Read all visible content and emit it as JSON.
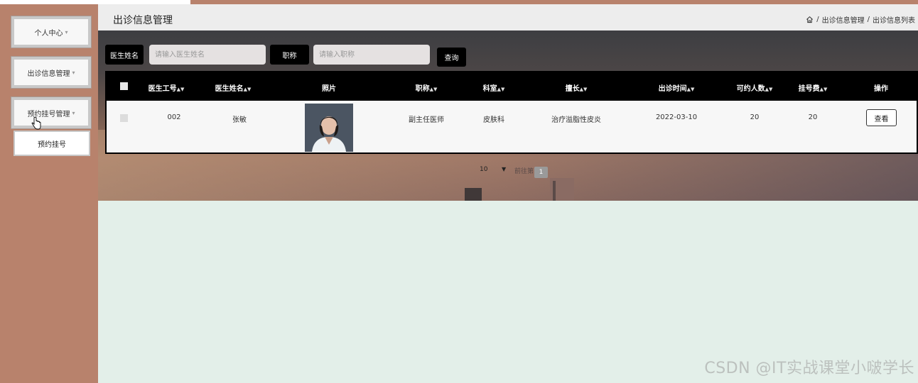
{
  "sidebar": {
    "items": [
      {
        "label": "个人中心",
        "caret": "▾"
      },
      {
        "label": "出诊信息管理",
        "caret": "▾"
      },
      {
        "label": "预约挂号管理",
        "caret": "▾"
      }
    ],
    "sub_item": "预约挂号"
  },
  "header": {
    "title": "出诊信息管理",
    "breadcrumb": [
      "出诊信息管理",
      "出诊信息列表"
    ],
    "separator": "/"
  },
  "search": {
    "doctor_name_label": "医生姓名",
    "doctor_name_placeholder": "请输入医生姓名",
    "title_label": "职称",
    "title_placeholder": "请输入职称",
    "query_button": "查询"
  },
  "table": {
    "columns": [
      "医生工号",
      "医生姓名",
      "照片",
      "职称",
      "科室",
      "擅长",
      "出诊时间",
      "可约人数",
      "挂号费",
      "操作"
    ],
    "rows": [
      {
        "id": "002",
        "name": "张敏",
        "title": "副主任医师",
        "dept": "皮肤科",
        "specialty": "治疗溢脂性皮炎",
        "date": "2022-03-10",
        "capacity": "20",
        "fee": "20",
        "action": "查看"
      }
    ]
  },
  "pagination": {
    "page_size": "10",
    "goto_label": "前往第",
    "current_page": "1"
  },
  "watermark": "CSDN @IT实战课堂小啵学长",
  "colors": {
    "sidebar": "#b8826c",
    "header": "#ededed",
    "content_bg": "#e3efe9",
    "table_header": "#000000"
  }
}
